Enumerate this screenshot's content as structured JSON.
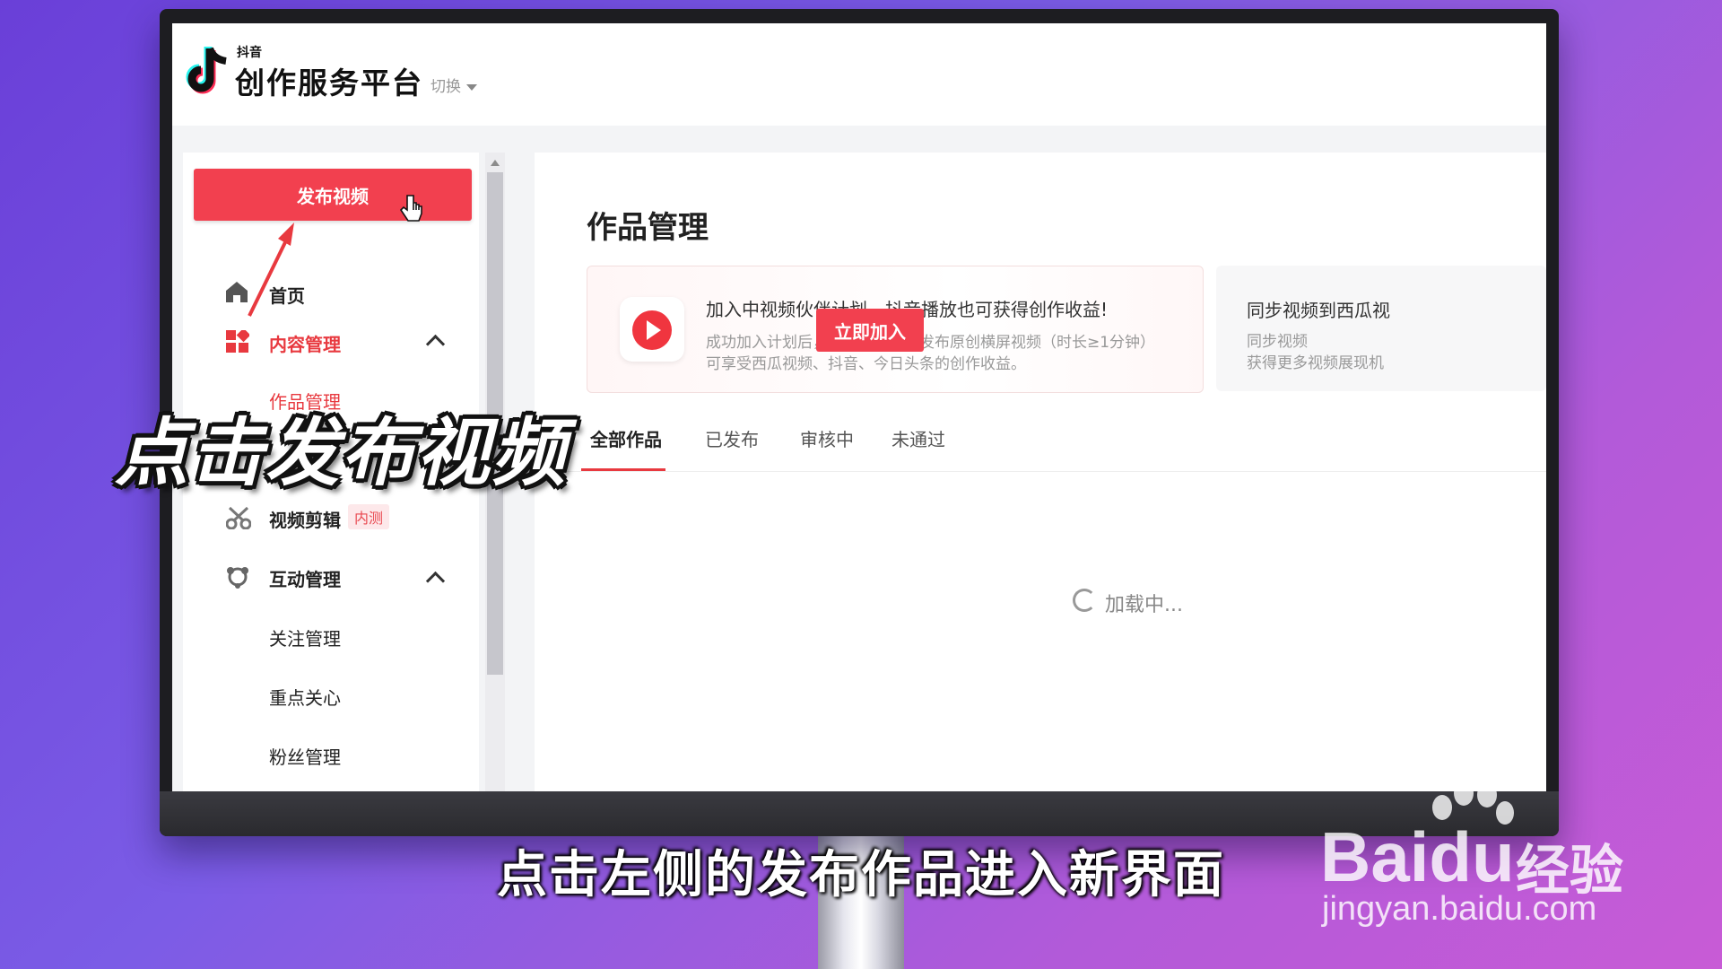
{
  "header": {
    "logo_small": "抖音",
    "logo_title": "创作服务平台",
    "switch_label": "切换"
  },
  "sidebar": {
    "publish_button": "发布视频",
    "items": [
      {
        "label": "首页",
        "icon": "home-icon"
      },
      {
        "label": "内容管理",
        "icon": "grid-icon",
        "expanded": true,
        "active": true
      },
      {
        "label": "作品管理",
        "sub": true,
        "active": true
      },
      {
        "label": "视频剪辑",
        "icon": "scissors-icon",
        "badge": "内测"
      },
      {
        "label": "互动管理",
        "icon": "interaction-icon",
        "expanded": true
      },
      {
        "label": "关注管理",
        "sub": true
      },
      {
        "label": "重点关心",
        "sub": true
      },
      {
        "label": "粉丝管理",
        "sub": true
      }
    ]
  },
  "main": {
    "title": "作品管理",
    "banner": {
      "title": "加入中视频伙伴计划，抖音播放也可获得创作收益!",
      "desc_line1": "成功加入计划后，通过西瓜视频发布原创横屏视频（时长≥1分钟）",
      "desc_line2": "可享受西瓜视频、抖音、今日头条的创作收益。",
      "button": "立即加入"
    },
    "banner2": {
      "title": "同步视频到西瓜视",
      "line1": "同步视频",
      "line2": "获得更多视频展现机"
    },
    "tabs": [
      "全部作品",
      "已发布",
      "审核中",
      "未通过"
    ],
    "active_tab": "全部作品",
    "loading_text": "加载中..."
  },
  "overlay": {
    "caption": "点击发布视频",
    "subtitle": "点击左侧的发布作品进入新界面",
    "watermark_brand": "Bai",
    "watermark_du": "du",
    "watermark_cn": "经验",
    "watermark_url": "jingyan.baidu.com"
  },
  "colors": {
    "accent": "#f2404f",
    "active_text": "#e8393f",
    "background_gradient_start": "#6a3fd8",
    "background_gradient_end": "#c85bd6"
  }
}
